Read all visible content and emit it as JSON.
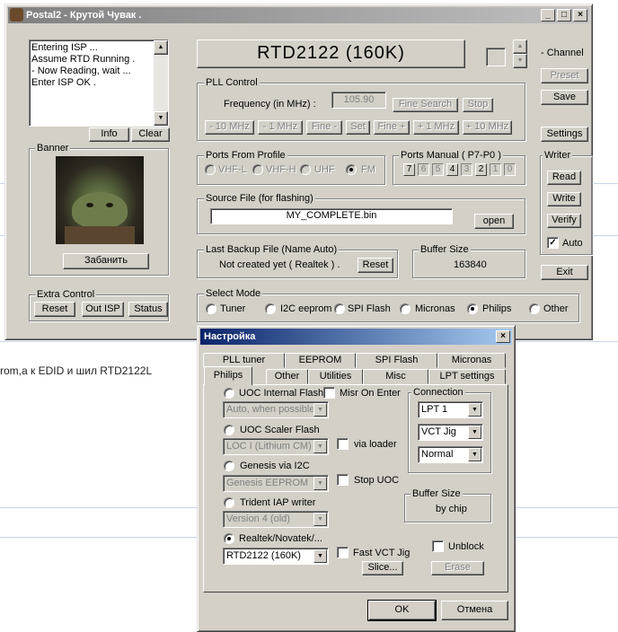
{
  "background": {
    "fragment_text": "rom,а к EDID и шил RTD2122L"
  },
  "main": {
    "title": "Postal2 - Крутой Чувак .",
    "log_lines": [
      "Entering ISP ...",
      "Assume RTD Running .",
      "- Now Reading, wait ...",
      "Enter ISP OK ."
    ],
    "info_label": "Info",
    "clear_label": "Clear",
    "banner_label": "Banner",
    "ban_label": "Забанить",
    "extra_label": "Extra Control",
    "reset_label": "Reset",
    "outisp_label": "Out ISP",
    "status_label": "Status",
    "chip_display": "RTD2122  (160K)",
    "channel_label": "- Channel",
    "preset_label": "Preset",
    "save_label": "Save",
    "settings_label": "Settings",
    "pll": {
      "label": "PLL Control",
      "freq_label": "Frequency (in MHz) :",
      "freq_value": "105.90",
      "fine_search": "Fine Search",
      "stop": "Stop",
      "buttons": [
        "- 10 MHz",
        "- 1 MHz",
        "Fine -",
        "Set",
        "Fine +",
        "+ 1 MHz",
        "+ 10 MHz"
      ]
    },
    "ports_profile": {
      "label": "Ports From Profile",
      "options": [
        "VHF-L",
        "VHF-H",
        "UHF",
        "FM"
      ],
      "selected": "FM"
    },
    "ports_manual": {
      "label": "Ports Manual ( P7-P0 )",
      "digits": [
        "7",
        "6",
        "5",
        "4",
        "3",
        "2",
        "1",
        "0"
      ]
    },
    "source": {
      "label": "Source File (for flashing)",
      "file": "MY_COMPLETE.bin",
      "open": "open"
    },
    "backup": {
      "label": "Last Backup File (Name Auto)",
      "value": "Not created yet ( Realtek ) .",
      "reset": "Reset"
    },
    "buffer": {
      "label": "Buffer Size",
      "value": "163840"
    },
    "writer": {
      "label": "Writer",
      "read": "Read",
      "write": "Write",
      "verify": "Verify",
      "auto": "Auto",
      "auto_checked": true
    },
    "exit_label": "Exit",
    "mode": {
      "label": "Select Mode",
      "options": [
        "Tuner",
        "I2C eeprom",
        "SPI Flash",
        "Micronas",
        "Philips",
        "Other"
      ],
      "selected": "Philips"
    }
  },
  "dialog": {
    "title": "Настройка",
    "tabs_row1": [
      "PLL tuner",
      "EEPROM",
      "SPI Flash",
      "Micronas"
    ],
    "tabs_row2": [
      "Philips",
      "Other",
      "Utilities",
      "Misc",
      "LPT settings"
    ],
    "active_tab": "Philips",
    "uoc_internal": "UOC Internal Flash",
    "misr": "Misr On Enter",
    "auto_possible": "Auto, when possible",
    "uoc_scaler": "UOC Scaler Flash",
    "loc": "LOC I  (Lithium CM)",
    "via_loader": "via loader",
    "genesis": "Genesis via I2C",
    "genesis_eeprom": "Genesis EEPROM",
    "stop_uoc": "Stop UOC",
    "trident": "Trident IAP writer",
    "version": "Version 4 (old)",
    "realtek": "Realtek/Novatek/...",
    "realtek_chip": "RTD2122  (160K)",
    "fast_vct": "Fast VCT Jig",
    "unblock": "Unblock",
    "slice": "Slice...",
    "erase": "Erase",
    "connection": {
      "label": "Connection",
      "port": "LPT 1",
      "jig": "VCT Jig",
      "mode": "Normal"
    },
    "buffer_label": "Buffer Size",
    "buffer_value": "by chip",
    "ok": "OK",
    "cancel": "Отмена"
  }
}
